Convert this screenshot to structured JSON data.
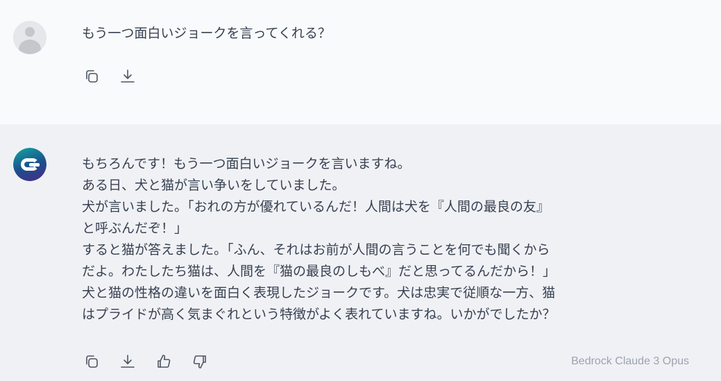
{
  "user_message": {
    "text": "もう一つ面白いジョークを言ってくれる？",
    "icons": [
      "copy-icon",
      "download-icon"
    ]
  },
  "assistant_message": {
    "lines": [
      "もちろんです！もう一つ面白いジョークを言いますね。",
      "ある日、犬と猫が言い争いをしていました。",
      "犬が言いました。「おれの方が優れているんだ！人間は犬を『人間の最良の友』",
      "と呼ぶんだぞ！」",
      "すると猫が答えました。「ふん、それはお前が人間の言うことを何でも聞くから",
      "だよ。わたしたち猫は、人間を『猫の最良のしもべ』だと思ってるんだから！」",
      "犬と猫の性格の違いを面白く表現したジョークです。犬は忠実で従順な一方、猫",
      "はプライドが高く気まぐれという特徴がよく表れていますね。いかがでしたか？"
    ],
    "icons": [
      "copy-icon",
      "download-icon",
      "thumbs-up-icon",
      "thumbs-down-icon"
    ],
    "model_label": "Bedrock Claude 3 Opus"
  }
}
